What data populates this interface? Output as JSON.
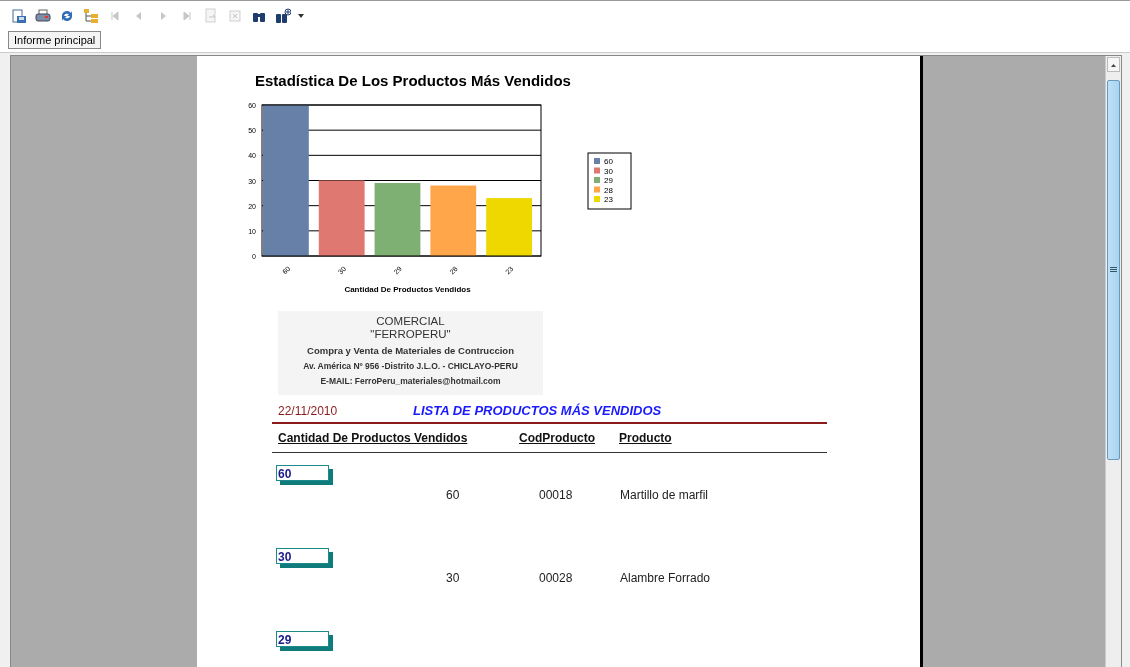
{
  "toolbar": {
    "buttons": [
      {
        "kind": "export",
        "disabled": false
      },
      {
        "kind": "print",
        "disabled": false
      },
      {
        "kind": "refresh",
        "disabled": false
      },
      {
        "kind": "tree",
        "disabled": false
      },
      {
        "kind": "first",
        "disabled": true
      },
      {
        "kind": "prev",
        "disabled": true
      },
      {
        "kind": "next",
        "disabled": true
      },
      {
        "kind": "last",
        "disabled": true
      },
      {
        "kind": "back",
        "disabled": true
      },
      {
        "kind": "stop",
        "disabled": true
      },
      {
        "kind": "find",
        "disabled": false
      },
      {
        "kind": "findnext",
        "disabled": false
      }
    ]
  },
  "tabs": [
    {
      "label": "Informe principal",
      "selected": true
    }
  ],
  "report": {
    "chart": {
      "chart_data": {
        "type": "bar",
        "title": "Estadística De Los Productos Más Vendidos",
        "xlabel": "Cantidad De Productos Vendidos",
        "categories": [
          "60",
          "30",
          "29",
          "28",
          "23"
        ],
        "ylim": [
          0,
          60
        ],
        "grid": true,
        "legend": true,
        "yticks": [
          0,
          10,
          20,
          30,
          40,
          50,
          60
        ],
        "series": [
          {
            "name": "60",
            "color": "#6680a8",
            "values": [
              60,
              null,
              null,
              null,
              null
            ]
          },
          {
            "name": "30",
            "color": "#e07872",
            "values": [
              null,
              30,
              null,
              null,
              null
            ]
          },
          {
            "name": "29",
            "color": "#7db072",
            "values": [
              null,
              null,
              29,
              null,
              null
            ]
          },
          {
            "name": "28",
            "color": "#ffa54a",
            "values": [
              null,
              null,
              null,
              28,
              null
            ]
          },
          {
            "name": "23",
            "color": "#eed800",
            "values": [
              null,
              null,
              null,
              null,
              23
            ]
          }
        ]
      }
    },
    "letterhead": {
      "company": "COMERCIAL",
      "name": "\"FERROPERU\"",
      "tagline": "Compra y Venta de Materiales de Contruccion",
      "address": "Av. América Nº 956 -Distrito J.L.O. -  CHICLAYO-PERU",
      "email": "E-MAIL: FerroPeru_materiales@hotmail.com"
    },
    "date": "22/11/2010",
    "title": "LISTA DE PRODUCTOS MÁS VENDIDOS",
    "columns": [
      "Cantidad De Productos Vendidos",
      "CodProducto",
      "Producto"
    ],
    "rows": [
      {
        "box_value": "60",
        "quantity": "60",
        "code": "00018",
        "product": "Martillo de marfil"
      },
      {
        "box_value": "30",
        "quantity": "30",
        "code": "00028",
        "product": "Alambre Forrado"
      },
      {
        "box_value": "29"
      }
    ]
  }
}
